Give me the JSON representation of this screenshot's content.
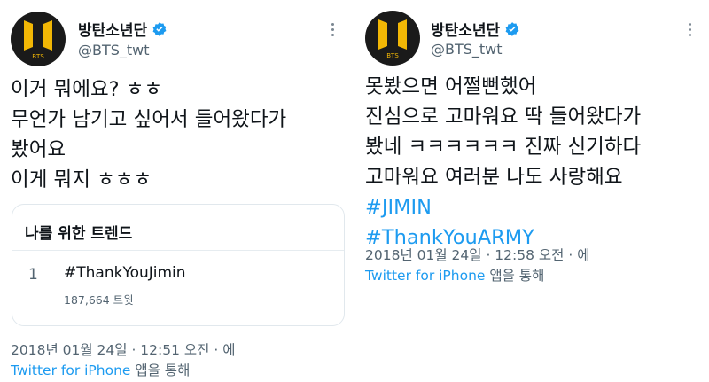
{
  "account": {
    "display_name": "방탄소년단",
    "handle": "@BTS_twt",
    "logo_text": "BTS"
  },
  "left_tweet": {
    "lines": [
      "이거 뭐에요? ㅎㅎ",
      "무언가 남기고 싶어서 들어왔다가",
      "봤어요",
      "이게 뭐지 ㅎㅎㅎ"
    ],
    "trend_card": {
      "header": "나를 위한 트렌드",
      "rank": "1",
      "trend": "#ThankYouJimin",
      "count": "187,664 트윗"
    },
    "timestamp": "2018년 01월 24일 · 12:51 오전 · 에",
    "source_app": "Twitter for iPhone",
    "source_suffix": " 앱을 통해"
  },
  "right_tweet": {
    "lines": [
      "못봤으면 어쩔뻔했어",
      "진심으로 고마워요 딱 들어왔다가",
      "봤네 ㅋㅋㅋㅋㅋㅋ 진짜 신기하다",
      "고마워요 여러분 나도 사랑해요"
    ],
    "hashtags": [
      "#JIMIN",
      "#ThankYouARMY"
    ],
    "timestamp": "2018년 01월 24일 · 12:58 오전 · 에",
    "source_app": "Twitter for iPhone",
    "source_suffix": " 앱을 통해"
  },
  "colors": {
    "link": "#1d9bf0",
    "text": "#0f1419",
    "secondary": "#536471",
    "logo_gold": "#f2b705",
    "avatar_bg": "#1a1a1a"
  },
  "icons": [
    "bts-logo-icon",
    "verified-badge-icon",
    "more-options-icon"
  ]
}
